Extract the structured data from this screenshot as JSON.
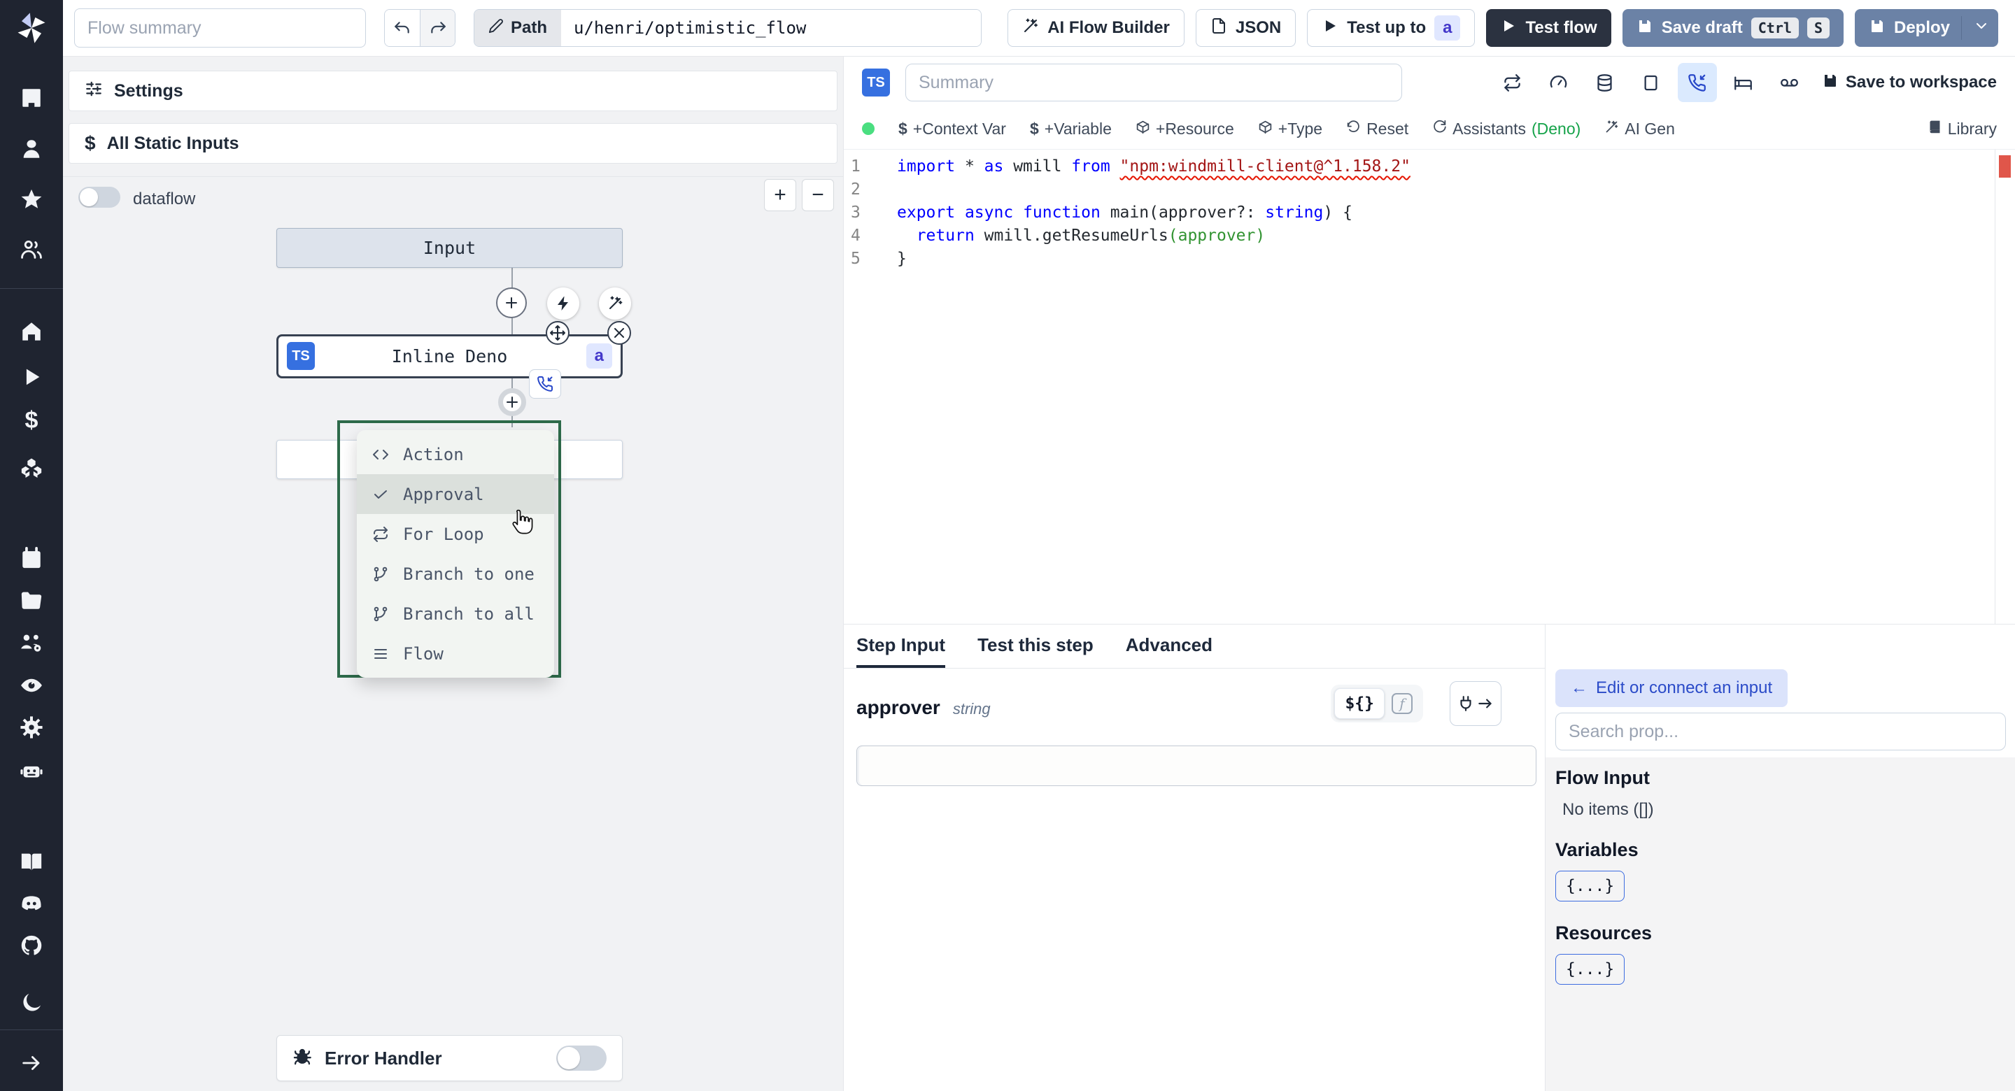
{
  "topbar": {
    "flow_summary_placeholder": "Flow summary",
    "path_label": "Path",
    "path_value": "u/henri/optimistic_flow",
    "ai_flow_builder": "AI Flow Builder",
    "json_btn": "JSON",
    "test_up_to": "Test up to",
    "test_up_to_badge": "a",
    "test_flow": "Test flow",
    "save_draft": "Save draft",
    "kbd_ctrl": "Ctrl",
    "kbd_s": "S",
    "deploy": "Deploy"
  },
  "sidebar": {
    "icons": [
      "building-icon",
      "user-icon",
      "star-icon",
      "users-icon",
      "home-icon",
      "play-icon",
      "dollar-icon",
      "cubes-icon",
      "calendar-icon",
      "folder-icon",
      "users-gear-icon",
      "eye-icon",
      "gear-icon",
      "robot-icon",
      "book-icon",
      "discord-icon",
      "github-icon",
      "moon-icon",
      "arrow-right-icon"
    ],
    "dollar_glyph": "$"
  },
  "flow": {
    "settings_label": "Settings",
    "static_inputs_label": "All Static Inputs",
    "dataflow_label": "dataflow",
    "zoom_in": "+",
    "zoom_out": "−",
    "input_node_label": "Input",
    "node": {
      "lang_badge": "TS",
      "label": "Inline Deno",
      "id_badge": "a"
    },
    "menu": {
      "items": [
        {
          "label": "Action",
          "icon": "code-icon",
          "highlighted": false
        },
        {
          "label": "Approval",
          "icon": "check-icon",
          "highlighted": true
        },
        {
          "label": "For Loop",
          "icon": "repeat-icon",
          "highlighted": false
        },
        {
          "label": "Branch to one",
          "icon": "branch-icon",
          "highlighted": false
        },
        {
          "label": "Branch to all",
          "icon": "branch-icon",
          "highlighted": false
        },
        {
          "label": "Flow",
          "icon": "flow-icon",
          "highlighted": false
        }
      ]
    },
    "error_handler_label": "Error Handler"
  },
  "editor": {
    "lang_badge": "TS",
    "summary_placeholder": "Summary",
    "save_to_workspace": "Save to workspace",
    "toolbar": {
      "dollar": "$",
      "context_var": "+Context Var",
      "variable": "+Variable",
      "resource": "+Resource",
      "type": "+Type",
      "reset": "Reset",
      "assistants": "Assistants",
      "assistants_lang": "(Deno)",
      "ai_gen": "AI Gen",
      "library": "Library"
    },
    "code": {
      "lines": [
        {
          "num": "1",
          "tokens": [
            {
              "t": "import",
              "c": "kw"
            },
            {
              "t": " * ",
              "c": "pl"
            },
            {
              "t": "as",
              "c": "kw"
            },
            {
              "t": " wmill ",
              "c": "pl"
            },
            {
              "t": "from",
              "c": "kw"
            },
            {
              "t": " ",
              "c": "pl"
            },
            {
              "t": "\"npm:windmill-client@^1.158.2\"",
              "c": "str sq"
            }
          ]
        },
        {
          "num": "2",
          "tokens": []
        },
        {
          "num": "3",
          "tokens": [
            {
              "t": "export",
              "c": "kw"
            },
            {
              "t": " ",
              "c": "pl"
            },
            {
              "t": "async",
              "c": "kw"
            },
            {
              "t": " ",
              "c": "pl"
            },
            {
              "t": "function",
              "c": "kw"
            },
            {
              "t": " main",
              "c": "pl"
            },
            {
              "t": "(",
              "c": "b1"
            },
            {
              "t": "approver?: ",
              "c": "pl"
            },
            {
              "t": "string",
              "c": "kw"
            },
            {
              "t": ") ",
              "c": "b1"
            },
            {
              "t": "{",
              "c": "b1"
            }
          ]
        },
        {
          "num": "4",
          "tokens": [
            {
              "t": "  ",
              "c": "pl"
            },
            {
              "t": "return",
              "c": "kw"
            },
            {
              "t": " wmill.getResumeUrls",
              "c": "pl"
            },
            {
              "t": "(approver)",
              "c": "b2"
            }
          ]
        },
        {
          "num": "5",
          "tokens": [
            {
              "t": "}",
              "c": "b1"
            }
          ]
        }
      ]
    }
  },
  "step": {
    "tabs": {
      "step_input": "Step Input",
      "test_this_step": "Test this step",
      "advanced": "Advanced"
    },
    "prop_name": "approver",
    "prop_type": "string",
    "expr_btn": "${}",
    "fn_btn": "f"
  },
  "right": {
    "back_arrow": "←",
    "edit_connect": "Edit or connect an input",
    "search_placeholder": "Search prop...",
    "flow_input": "Flow Input",
    "no_items": "No items ([])",
    "variables": "Variables",
    "resources": "Resources",
    "object_chip": "{...}"
  },
  "colors": {
    "sidebar_bg": "#1f2430",
    "primary_button": "#6b82a6",
    "dark_button": "#2b3240",
    "ts_badge_blue": "#3670e0",
    "id_badge_bg": "#e0e7ff",
    "id_badge_text": "#4338ca",
    "menu_border_green": "#2d6a4a",
    "status_green": "#4ade80",
    "deno_green": "#16a34a",
    "error_marker": "#e0564a",
    "keyword_blue": "#0000ff",
    "string_red": "#a31515",
    "highlight_blue_bg": "#dbeafe"
  }
}
